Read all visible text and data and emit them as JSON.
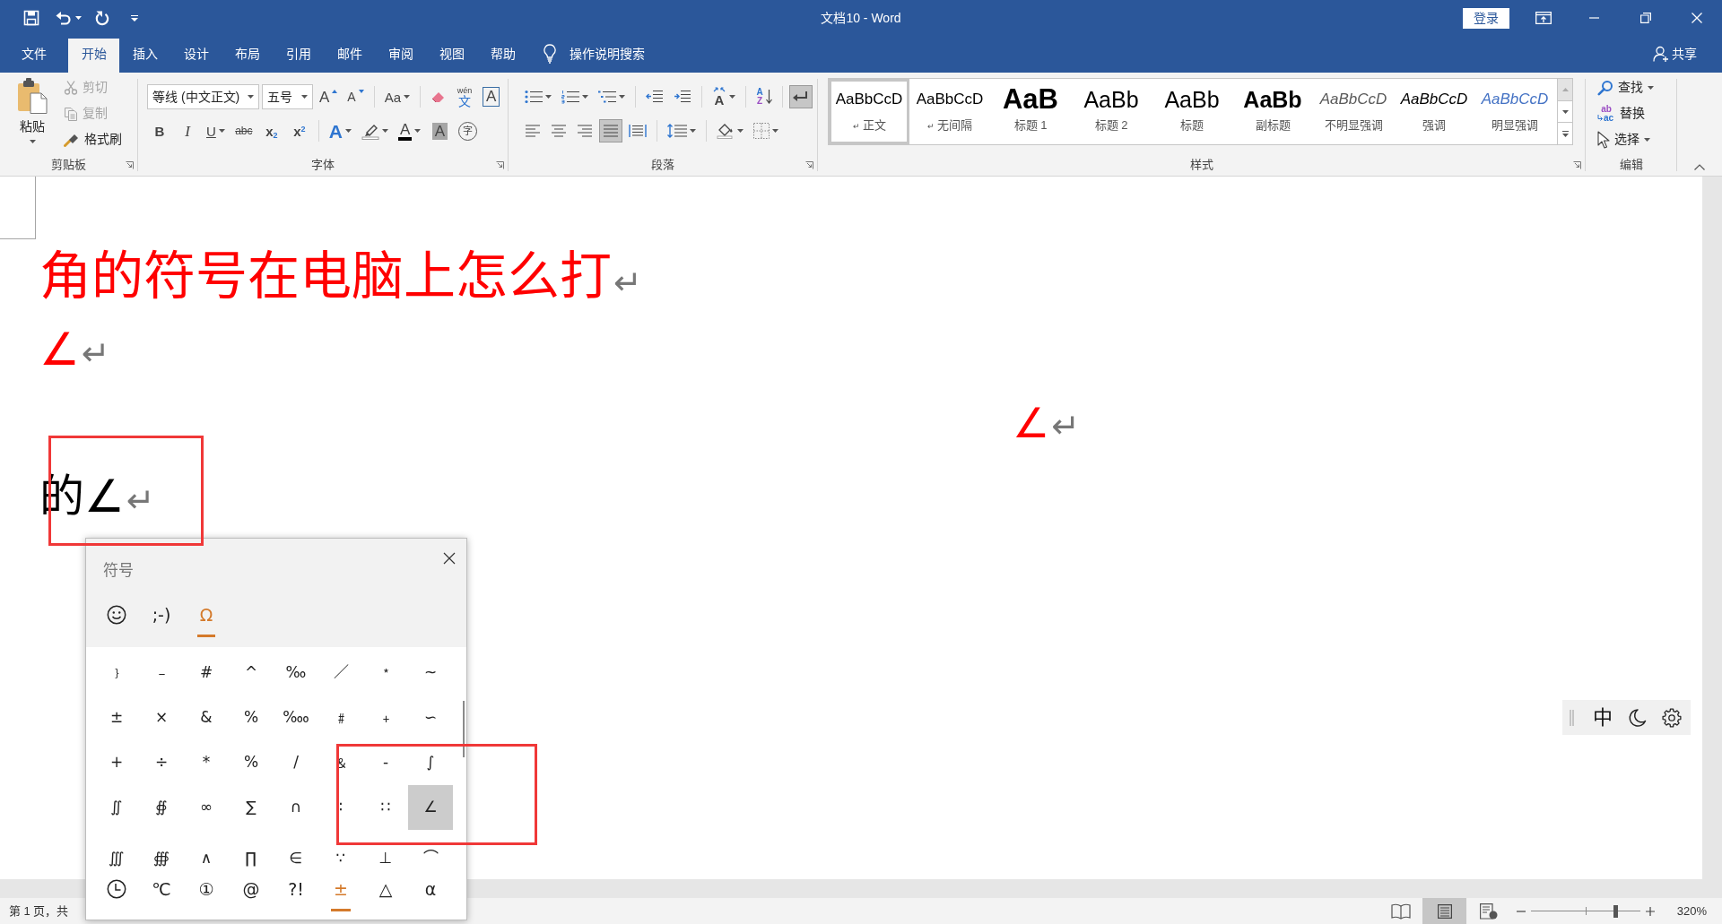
{
  "title_bar": {
    "title": "文档10 - Word",
    "sign_in": "登录"
  },
  "tabs": [
    {
      "label": "文件",
      "selected": false
    },
    {
      "label": "开始",
      "selected": true
    },
    {
      "label": "插入",
      "selected": false
    },
    {
      "label": "设计",
      "selected": false
    },
    {
      "label": "布局",
      "selected": false
    },
    {
      "label": "引用",
      "selected": false
    },
    {
      "label": "邮件",
      "selected": false
    },
    {
      "label": "审阅",
      "selected": false
    },
    {
      "label": "视图",
      "selected": false
    },
    {
      "label": "帮助",
      "selected": false
    }
  ],
  "tell_me": "操作说明搜索",
  "share": "共享",
  "ribbon": {
    "clipboard": {
      "paste": "粘贴",
      "commands": [
        {
          "kind": "cut",
          "label": "剪切",
          "disabled": true
        },
        {
          "kind": "copy",
          "label": "复制",
          "disabled": true
        },
        {
          "kind": "format_painter",
          "label": "格式刷",
          "disabled": false
        }
      ],
      "label": "剪贴板"
    },
    "font": {
      "font_name": "等线 (中文正文)",
      "font_size": "五号",
      "row_1": [
        [
          {
            "kind": "grow",
            "text": "A",
            "dropdown": false
          },
          {
            "kind": "shrink",
            "text": "A",
            "dropdown": false
          }
        ],
        [
          {
            "kind": "case",
            "text": "Aa",
            "dropdown": true
          }
        ],
        [
          {
            "kind": "clear",
            "dropdown": false
          },
          {
            "kind": "phonetic",
            "ruby": "wén",
            "text": "文",
            "dropdown": false
          },
          {
            "kind": "border",
            "text": "A",
            "dropdown": false
          }
        ]
      ],
      "row_2": [
        [
          {
            "kind": "bold",
            "text": "B",
            "dropdown": false
          },
          {
            "kind": "italic",
            "text": "I",
            "dropdown": false
          },
          {
            "kind": "underline",
            "text": "U",
            "dropdown": true
          },
          {
            "kind": "strike",
            "text": "abc",
            "dropdown": false
          },
          {
            "kind": "subscript",
            "text": "x$_{2}$",
            "dropdown": false
          },
          {
            "kind": "superscript",
            "text": "x$^{2}$",
            "dropdown": false
          }
        ],
        [
          {
            "kind": "effects",
            "text": "A",
            "dropdown": true
          },
          {
            "kind": "highlight",
            "dropdown": true
          },
          {
            "kind": "color",
            "text": "A",
            "dropdown": true
          },
          {
            "kind": "shading",
            "text": "A",
            "dropdown": false
          },
          {
            "kind": "enclose",
            "text": "字",
            "dropdown": false
          }
        ]
      ],
      "label": "字体"
    },
    "paragraph": {
      "row_1": [
        [
          {
            "kind": "bullets",
            "dropdown": true,
            "on": false
          },
          {
            "kind": "numbering",
            "dropdown": true,
            "on": false
          },
          {
            "kind": "multilevel",
            "dropdown": true,
            "on": false
          }
        ],
        [
          {
            "kind": "outdent",
            "dropdown": false,
            "on": false
          },
          {
            "kind": "indent",
            "dropdown": false,
            "on": false
          }
        ],
        [
          {
            "kind": "asian_layout",
            "text": "A",
            "dropdown": true,
            "on": false
          }
        ],
        [
          {
            "kind": "sort",
            "text": "A",
            "text_2": "Z",
            "dropdown": false,
            "on": false
          }
        ],
        [
          {
            "kind": "marks",
            "dropdown": false,
            "on": true
          }
        ]
      ],
      "row_2": [
        [
          {
            "kind": "align_left",
            "dropdown": false,
            "on": false
          },
          {
            "kind": "align_center",
            "dropdown": false,
            "on": false
          },
          {
            "kind": "align_right",
            "dropdown": false,
            "on": false
          },
          {
            "kind": "justify",
            "dropdown": false,
            "on": true
          },
          {
            "kind": "distribute",
            "dropdown": false,
            "on": false
          }
        ],
        [
          {
            "kind": "line_spacing",
            "dropdown": true,
            "on": false
          }
        ],
        [
          {
            "kind": "shading",
            "dropdown": true,
            "on": false
          },
          {
            "kind": "borders",
            "dropdown": true,
            "on": false
          }
        ]
      ],
      "label": "段落"
    },
    "styles": {
      "items": [
        {
          "kind": "normal",
          "preview": "AaBbCcD",
          "mark": "↵",
          "name": "正文",
          "selected": true
        },
        {
          "kind": "normal",
          "preview": "AaBbCcD",
          "mark": "↵",
          "name": "无间隔",
          "selected": false
        },
        {
          "kind": "heading_1",
          "preview": "AaB",
          "name": "标题 1",
          "selected": false
        },
        {
          "kind": "heading_2",
          "preview": "AaBb",
          "name": "标题 2",
          "selected": false
        },
        {
          "kind": "title",
          "preview": "AaBb",
          "name": "标题",
          "selected": false
        },
        {
          "kind": "subtitle",
          "preview": "AaBb",
          "name": "副标题",
          "selected": false
        },
        {
          "kind": "subtle",
          "preview": "AaBbCcD",
          "name": "不明显强调",
          "selected": false
        },
        {
          "kind": "emphasis",
          "preview": "AaBbCcD",
          "name": "强调",
          "selected": false
        },
        {
          "kind": "intense",
          "preview": "AaBbCcD",
          "name": "明显强调",
          "selected": false
        }
      ],
      "scroll_up": {
        "disabled": true
      },
      "label": "样式"
    },
    "editing": {
      "commands": [
        {
          "kind": "find",
          "label": "查找",
          "dropdown": true
        },
        {
          "kind": "replace",
          "text": "ab",
          "text_2": "ac",
          "label": "替换",
          "dropdown": false
        },
        {
          "kind": "select",
          "label": "选择",
          "dropdown": true
        }
      ],
      "label": "编辑"
    }
  },
  "document": {
    "paragraphs": [
      {
        "kind": "heading",
        "runs": [
          {
            "text": "角的符号在电脑上怎么打",
            "color": "#ff0000"
          }
        ],
        "mark": "↵"
      },
      {
        "kind": "body",
        "runs": [
          {
            "text": "∠",
            "color": "#ff0000"
          }
        ],
        "mark": "↵"
      },
      {
        "kind": "indented",
        "runs": [
          {
            "text": "∠",
            "color": "#ff0000"
          }
        ],
        "mark": "↵"
      },
      {
        "kind": "body",
        "runs": [
          {
            "text": "的∠",
            "color": "#000000"
          }
        ],
        "mark": "↵"
      }
    ]
  },
  "symbol_panel": {
    "title": "符号",
    "tabs": [
      {
        "kind": "emoji",
        "selected": false
      },
      {
        "kind": "kaomoji",
        "text": ";-)",
        "selected": false
      },
      {
        "kind": "symbols",
        "text": "Ω",
        "selected": true
      }
    ],
    "rows": [
      [
        {
          "text": "﹜",
          "selected": false
        },
        {
          "text": "﹣",
          "selected": false
        },
        {
          "text": "#",
          "selected": false
        },
        {
          "text": "^",
          "selected": false
        },
        {
          "text": "‰",
          "selected": false
        },
        {
          "text": "／",
          "selected": false
        },
        {
          "text": "﹡",
          "selected": false
        },
        {
          "text": "~",
          "selected": false
        }
      ],
      [
        {
          "text": "±",
          "selected": false
        },
        {
          "text": "×",
          "selected": false
        },
        {
          "text": "&",
          "selected": false
        },
        {
          "text": "%",
          "selected": false
        },
        {
          "text": "‱",
          "selected": false
        },
        {
          "text": "﹟",
          "selected": false
        },
        {
          "text": "﹢",
          "selected": false
        },
        {
          "text": "∽",
          "selected": false
        }
      ],
      [
        {
          "text": "+",
          "selected": false
        },
        {
          "text": "÷",
          "selected": false
        },
        {
          "text": "*",
          "selected": false
        },
        {
          "text": "%",
          "selected": false
        },
        {
          "text": "/",
          "selected": false
        },
        {
          "text": "﹠",
          "selected": false
        },
        {
          "text": "-",
          "selected": false
        },
        {
          "text": "∫",
          "selected": false
        }
      ],
      [
        {
          "text": "∬",
          "selected": false
        },
        {
          "text": "∯",
          "selected": false
        },
        {
          "text": "∞",
          "selected": false
        },
        {
          "text": "∑",
          "selected": false
        },
        {
          "text": "∩",
          "selected": false
        },
        {
          "text": "∶",
          "selected": false
        },
        {
          "text": "∷",
          "selected": false
        },
        {
          "text": "∠",
          "selected": true
        }
      ],
      [
        {
          "text": "∭",
          "selected": false
        },
        {
          "text": "∰",
          "selected": false
        },
        {
          "text": "∧",
          "selected": false
        },
        {
          "text": "∏",
          "selected": false
        },
        {
          "text": "∈",
          "selected": false
        },
        {
          "text": "∵",
          "selected": false
        },
        {
          "text": "⊥",
          "selected": false
        },
        {
          "text": "⌒",
          "selected": false
        }
      ]
    ],
    "categories": [
      {
        "kind": "recent",
        "selected": false
      },
      {
        "kind": "symbol",
        "text": "℃",
        "selected": false
      },
      {
        "kind": "symbol",
        "text": "①",
        "selected": false
      },
      {
        "kind": "symbol",
        "text": "@",
        "selected": false
      },
      {
        "kind": "symbol",
        "text": "?!",
        "selected": false
      },
      {
        "kind": "symbol",
        "text": "±",
        "selected": true
      },
      {
        "kind": "symbol",
        "text": "△",
        "selected": false
      },
      {
        "kind": "symbol",
        "text": "α",
        "selected": false
      }
    ]
  },
  "ime": {
    "mode": "中"
  },
  "status_bar": {
    "page_info": "第 1 页，共",
    "views": [
      {
        "kind": "read",
        "selected": false
      },
      {
        "kind": "print",
        "selected": true
      },
      {
        "kind": "web",
        "selected": false
      }
    ],
    "zoom": {
      "level": 0.77,
      "reading": "320%"
    }
  }
}
